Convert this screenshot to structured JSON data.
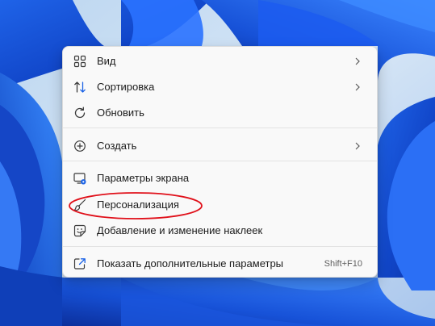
{
  "desktop": {
    "accent_color": "#1a62e6"
  },
  "context_menu": {
    "items": [
      {
        "label": "Вид",
        "icon": "grid-icon",
        "has_submenu": true
      },
      {
        "label": "Сортировка",
        "icon": "sort-icon",
        "has_submenu": true
      },
      {
        "label": "Обновить",
        "icon": "refresh-icon",
        "has_submenu": false
      },
      {
        "label": "Создать",
        "icon": "add-circle-icon",
        "has_submenu": true
      },
      {
        "label": "Параметры экрана",
        "icon": "display-settings-icon",
        "has_submenu": false
      },
      {
        "label": "Персонализация",
        "icon": "brush-icon",
        "has_submenu": false
      },
      {
        "label": "Добавление и изменение наклеек",
        "icon": "sticker-icon",
        "has_submenu": false
      },
      {
        "label": "Показать дополнительные параметры",
        "icon": "more-options-icon",
        "has_submenu": false,
        "shortcut": "Shift+F10"
      }
    ]
  },
  "annotation": {
    "color": "#e0101a",
    "target": "Персонализация"
  }
}
